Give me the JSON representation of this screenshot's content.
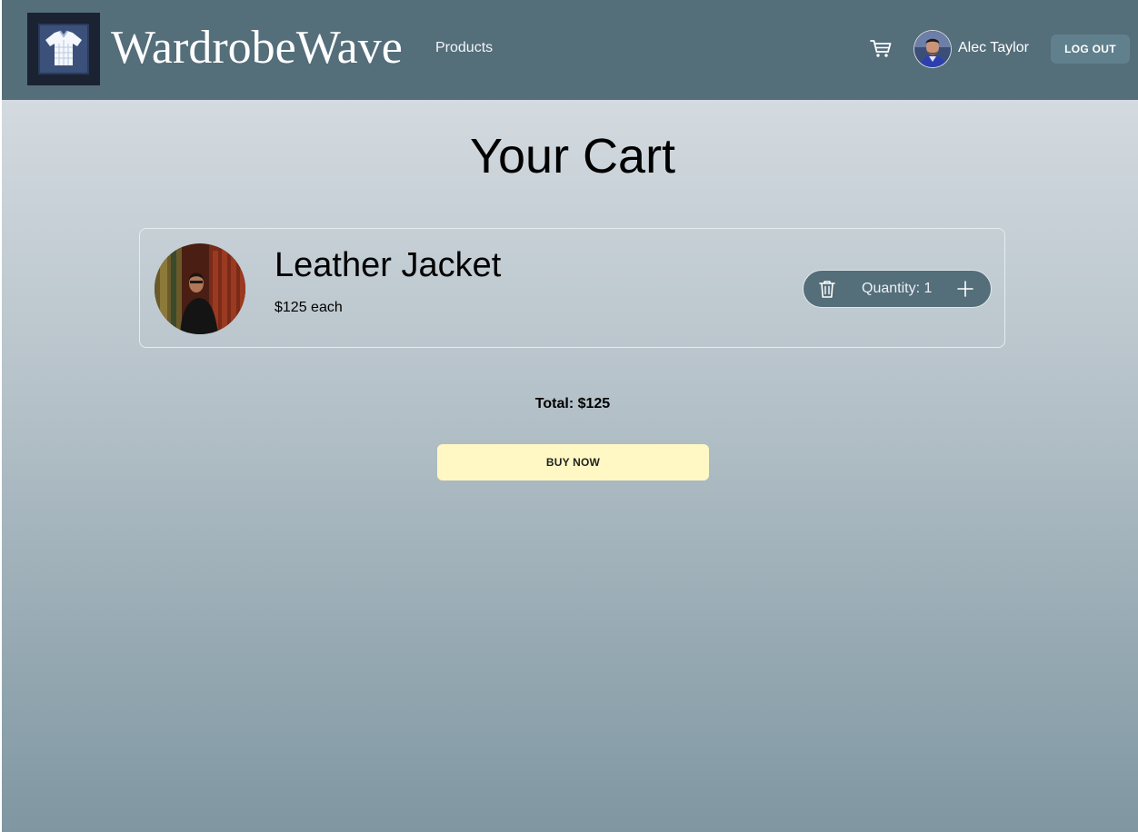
{
  "header": {
    "brand": "WardrobeWave",
    "nav_products": "Products",
    "user_name": "Alec Taylor",
    "logout_label": "LOG OUT",
    "background_color": "#546e7a"
  },
  "page": {
    "title": "Your Cart"
  },
  "cart": {
    "items": [
      {
        "name": "Leather Jacket",
        "price_text": "$125 each",
        "quantity_label": "Quantity: 1",
        "quantity": 1
      }
    ],
    "total_label": "Total:",
    "total_value": "$125",
    "buy_label": "BUY NOW",
    "buy_color": "#fff8c4"
  },
  "icons": {
    "logo": "polo-shirt-icon",
    "cart": "shopping-cart-icon",
    "remove": "trash-icon",
    "increase": "plus-icon"
  }
}
